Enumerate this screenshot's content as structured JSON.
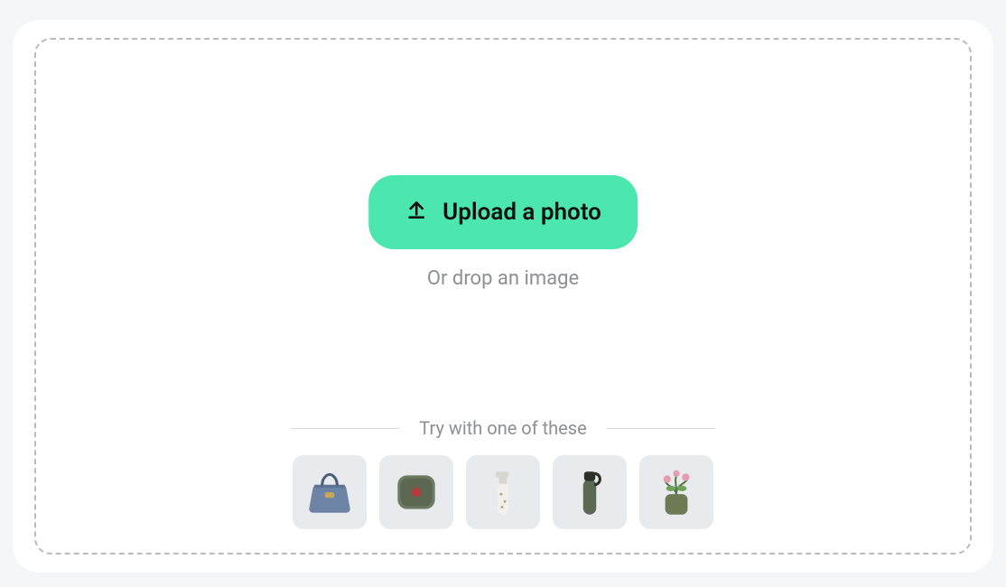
{
  "upload": {
    "button_label": "Upload a photo",
    "drop_hint": "Or drop an image"
  },
  "samples": {
    "header": "Try with one of these",
    "items": [
      {
        "name": "handbag"
      },
      {
        "name": "lunch-box"
      },
      {
        "name": "soap-dispenser"
      },
      {
        "name": "water-bottle"
      },
      {
        "name": "plant-pot"
      }
    ]
  }
}
